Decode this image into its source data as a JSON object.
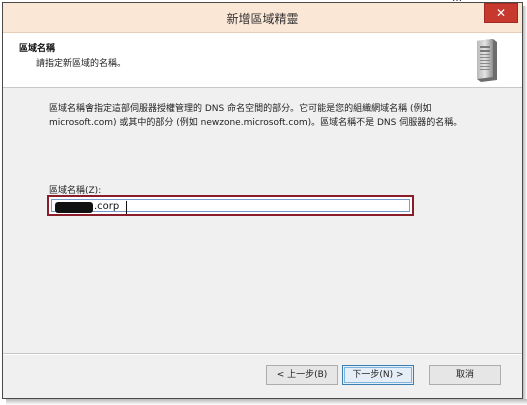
{
  "window": {
    "title": "新增區域精靈",
    "close_glyph": "✕",
    "top_fragment": "…"
  },
  "header": {
    "title": "區域名稱",
    "subtitle": "請指定新區域的名稱。",
    "icon": "server-tower-icon"
  },
  "content": {
    "description": "區域名稱會指定這部伺服器授權管理的 DNS 命名空間的部分。它可能是您的組織網域名稱 (例如 microsoft.com) 或其中的部分 (例如 newzone.microsoft.com)。區域名稱不是 DNS 伺服器的名稱。",
    "zone_name_label": "區域名稱(Z):",
    "zone_name_value": ".corp"
  },
  "buttons": {
    "back": "< 上一步(B)",
    "next": "下一步(N) >",
    "cancel": "取消"
  },
  "colors": {
    "titlebar": "#fbe7d6",
    "close": "#c7382f",
    "highlight_box": "#8b1d2a",
    "default_button_border": "#3c7fb1"
  }
}
